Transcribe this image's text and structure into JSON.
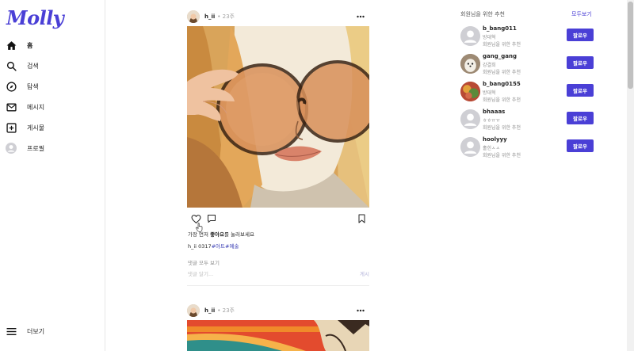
{
  "app": {
    "logo": "Molly",
    "accent": "#4a3fd6"
  },
  "sidebar": {
    "items": [
      {
        "label": "홈",
        "icon": "home-icon"
      },
      {
        "label": "검색",
        "icon": "search-icon"
      },
      {
        "label": "탐색",
        "icon": "compass-icon"
      },
      {
        "label": "메시지",
        "icon": "mail-icon"
      },
      {
        "label": "게시물",
        "icon": "plus-square-icon"
      },
      {
        "label": "프로필",
        "icon": "profile-icon"
      }
    ],
    "more_label": "더보기"
  },
  "posts": [
    {
      "user": "h_ii",
      "time": "• 23주",
      "likes_prefix": "가장 먼저 ",
      "likes_bold": "좋아요",
      "likes_suffix": "를 눌러보세요",
      "caption_user": "h_ii",
      "caption_text": "0317",
      "caption_tags": "#아트#예술",
      "view_comments": "댓글 모두 보기",
      "comment_placeholder": "댓글 달기...",
      "comment_post": "게시"
    },
    {
      "user": "h_ii",
      "time": "• 23주"
    }
  ],
  "suggestions": {
    "title": "회원님을 위한 추천",
    "see_all": "모두보기",
    "follow_label": "팔로우",
    "users": [
      {
        "name": "b_bang011",
        "nick": "방대혁",
        "note": "회원님을 위한 추천"
      },
      {
        "name": "gang_gang",
        "nick": "강결희",
        "note": "회원님을 위한 추천"
      },
      {
        "name": "b_bang0155",
        "nick": "방대혁",
        "note": "회원님을 위한 추천"
      },
      {
        "name": "bhaaas",
        "nick": "ㅎㅎㅠㅠ",
        "note": "회원님을 위한 추천"
      },
      {
        "name": "hoolyyy",
        "nick": "홀힌ㅅㅅ",
        "note": "회원님을 위한 추천"
      }
    ]
  }
}
